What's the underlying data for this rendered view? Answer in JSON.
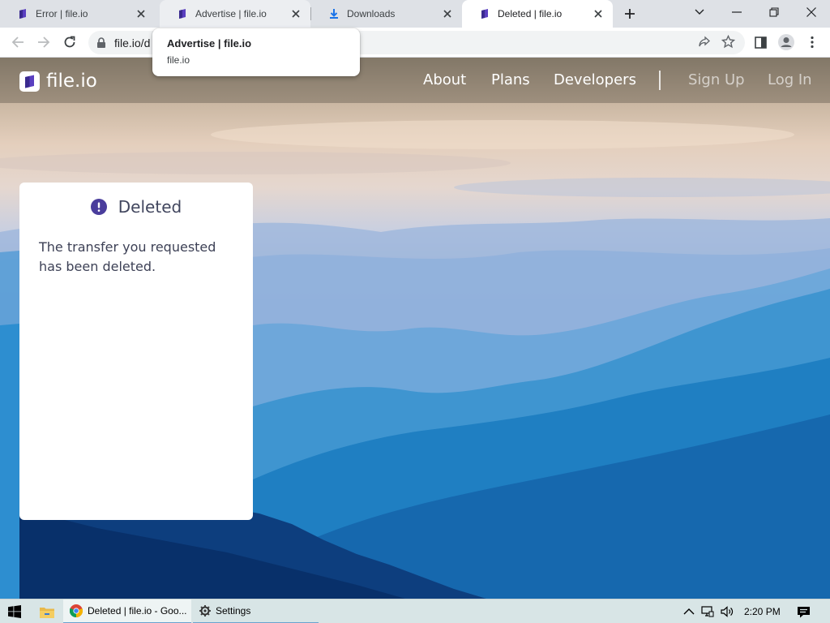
{
  "browser": {
    "tabs": [
      {
        "title": "Error | file.io",
        "icon": "fileio-icon"
      },
      {
        "title": "Advertise | file.io",
        "icon": "fileio-icon"
      },
      {
        "title": "Downloads",
        "icon": "download-icon"
      },
      {
        "title": "Deleted | file.io",
        "icon": "fileio-icon",
        "active": true
      }
    ],
    "address_bar": {
      "url": "file.io/d"
    },
    "hover_card": {
      "title": "Advertise | file.io",
      "domain": "file.io"
    }
  },
  "site": {
    "logo_text": "file.io",
    "nav": {
      "about": "About",
      "plans": "Plans",
      "developers": "Developers",
      "sign_up": "Sign Up",
      "log_in": "Log In"
    },
    "card": {
      "title": "Deleted",
      "message": "The transfer you requested has been deleted."
    },
    "colors": {
      "accent": "#4a3d9c",
      "card_title": "#41465e"
    }
  },
  "taskbar": {
    "items": [
      {
        "label": "Deleted | file.io - Goo...",
        "icon": "chrome-icon"
      },
      {
        "label": "Settings",
        "icon": "gear-icon"
      }
    ],
    "clock": "2:20 PM"
  }
}
